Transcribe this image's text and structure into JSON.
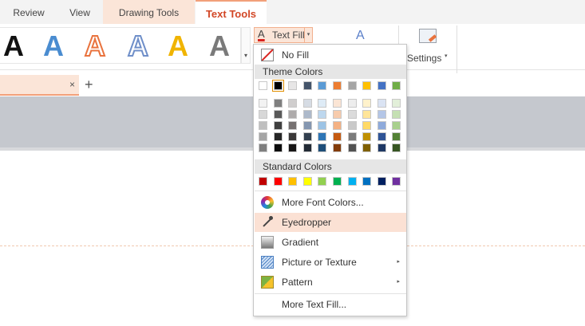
{
  "tabs": {
    "review": "Review",
    "view": "View",
    "drawing_tools": "Drawing Tools",
    "text_tools": "Text Tools"
  },
  "ribbon": {
    "gallery": {
      "letters": [
        "A",
        "A",
        "A",
        "A",
        "A",
        "A"
      ],
      "more_arrow": "▾"
    },
    "text_fill": {
      "icon_letter": "A",
      "label": "Text Fill",
      "caret": "▾"
    },
    "text_effect_icon": "A",
    "settings": {
      "label": "Settings",
      "caret": "▾"
    }
  },
  "document_tabs": {
    "close": "×",
    "add": "+"
  },
  "menu": {
    "no_fill": "No Fill",
    "theme_colors_header": "Theme Colors",
    "theme_colors_top": [
      "#ffffff",
      "#000000",
      "#e7e6e6",
      "#44546a",
      "#5b9bd5",
      "#ed7d31",
      "#a5a5a5",
      "#ffc000",
      "#4472c4",
      "#70ad47"
    ],
    "theme_colors_selected_index": 1,
    "theme_shades": [
      [
        "#f2f2f2",
        "#7f7f7f",
        "#d0cece",
        "#d6dce4",
        "#deebf6",
        "#fbe5d5",
        "#ededed",
        "#fff2cc",
        "#dae3f3",
        "#e2efd9"
      ],
      [
        "#d8d8d8",
        "#595959",
        "#aeabab",
        "#adb9ca",
        "#bdd7ee",
        "#f7cbac",
        "#dbdbdb",
        "#ffe599",
        "#b4c6e7",
        "#c5e0b3"
      ],
      [
        "#bfbfbf",
        "#3f3f3f",
        "#757070",
        "#8496b0",
        "#9cc3e5",
        "#f4b183",
        "#c9c9c9",
        "#ffd965",
        "#8eaadb",
        "#a8d08d"
      ],
      [
        "#a5a5a5",
        "#262626",
        "#3a3838",
        "#323f4f",
        "#2e75b5",
        "#c55a11",
        "#7b7b7b",
        "#bf9000",
        "#2f5496",
        "#538135"
      ],
      [
        "#7f7f7f",
        "#0c0c0c",
        "#171616",
        "#222a35",
        "#1e4e79",
        "#833c0b",
        "#525252",
        "#7f6000",
        "#1f3864",
        "#375623"
      ]
    ],
    "standard_colors_header": "Standard Colors",
    "standard_colors": [
      "#c00000",
      "#ff0000",
      "#ffc000",
      "#ffff00",
      "#92d050",
      "#00b050",
      "#00b0f0",
      "#0070c0",
      "#002060",
      "#7030a0"
    ],
    "more_font_colors": "More Font Colors...",
    "eyedropper": "Eyedropper",
    "gradient": "Gradient",
    "picture_or_texture": "Picture or Texture",
    "pattern": "Pattern",
    "submenu_arrow": "▸",
    "more_text_fill": "More Text Fill..."
  }
}
